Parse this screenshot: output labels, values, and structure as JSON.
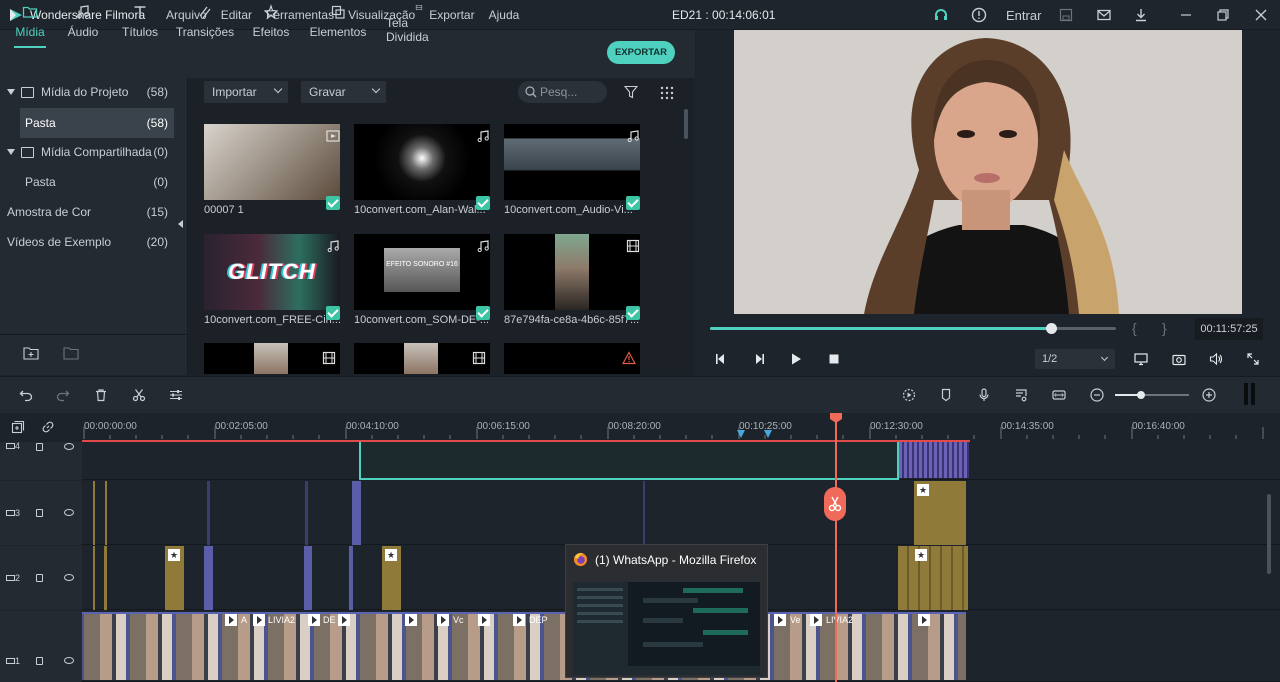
{
  "app": {
    "name": "Wondershare Filmora",
    "project": "ED21 : 00:14:06:01",
    "entrar": "Entrar"
  },
  "menu": [
    "Arquivo",
    "Editar",
    "Ferramentas",
    "Visualização",
    "Exportar",
    "Ajuda"
  ],
  "tabs": [
    {
      "label": "Mídia",
      "icon": "folder-icon",
      "active": true
    },
    {
      "label": "Áudio",
      "icon": "music-note-icon"
    },
    {
      "label": "Títulos",
      "icon": "text-icon"
    },
    {
      "label": "Transições",
      "icon": "transition-icon"
    },
    {
      "label": "Efeitos",
      "icon": "effects-icon"
    },
    {
      "label": "Elementos",
      "icon": "elements-icon"
    },
    {
      "label": "Tela Dividida",
      "icon": "split-screen-icon"
    }
  ],
  "export_label": "EXPORTAR",
  "library": [
    {
      "label": "Mídia do Projeto",
      "count": "(58)"
    },
    {
      "label": "Pasta",
      "count": "(58)"
    },
    {
      "label": "Mídia Compartilhada",
      "count": "(0)"
    },
    {
      "label": "Pasta",
      "count": "(0)"
    },
    {
      "label": "Amostra de Cor",
      "count": "(15)"
    },
    {
      "label": "Vídeos de Exemplo",
      "count": "(20)"
    }
  ],
  "media_toolbar": {
    "import": "Importar",
    "record": "Gravar",
    "search_placeholder": "Pesq..."
  },
  "media": [
    {
      "name": "00007 1",
      "type": "video-icon"
    },
    {
      "name": "10convert.com_Alan-Wal...",
      "type": "music-note-icon"
    },
    {
      "name": "10convert.com_Audio-Vi...",
      "type": "music-note-icon"
    },
    {
      "name": "10convert.com_FREE-Cin...",
      "type": "music-note-icon",
      "thumb_text": "GLITCH"
    },
    {
      "name": "10convert.com_SOM-DE-...",
      "type": "music-note-icon",
      "thumb_text": "EFEITO SONORO #16"
    },
    {
      "name": "87e794fa-ce8a-4b6c-85f7...",
      "type": "film-icon"
    }
  ],
  "player": {
    "time": "00:11:57:25",
    "quality": "1/2",
    "progress": 0.84
  },
  "ruler": [
    "00:00:00:00",
    "00:02:05:00",
    "00:04:10:00",
    "00:06:15:00",
    "00:08:20:00",
    "00:10:25:00",
    "00:12:30:00",
    "00:14:35:00",
    "00:16:40:00"
  ],
  "tracks": [
    {
      "label": "4"
    },
    {
      "label": "3"
    },
    {
      "label": "2"
    },
    {
      "label": "1"
    }
  ],
  "popup": {
    "title": "(1) WhatsApp - Mozilla Firefox"
  },
  "clip_labels": [
    "A",
    "LIVIA2",
    "DE",
    "Vc",
    "DEP",
    "Ve",
    "LIVIA2"
  ]
}
